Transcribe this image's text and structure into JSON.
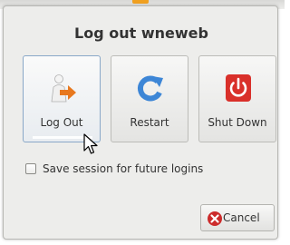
{
  "dialog": {
    "title": "Log out wneweb"
  },
  "actions": [
    {
      "label": "Log Out",
      "icon": "logout-icon"
    },
    {
      "label": "Restart",
      "icon": "restart-icon"
    },
    {
      "label": "Shut Down",
      "icon": "power-icon"
    }
  ],
  "options": {
    "save_session_label": "Save session for future logins",
    "save_session_checked": false
  },
  "footer": {
    "cancel_label": "Cancel",
    "cancel_icon": "cancel-icon"
  },
  "colors": {
    "power_red": "#d9302a",
    "restart_blue": "#3d86d6",
    "logout_orange": "#e8781e",
    "cancel_red": "#cc2b2b"
  }
}
